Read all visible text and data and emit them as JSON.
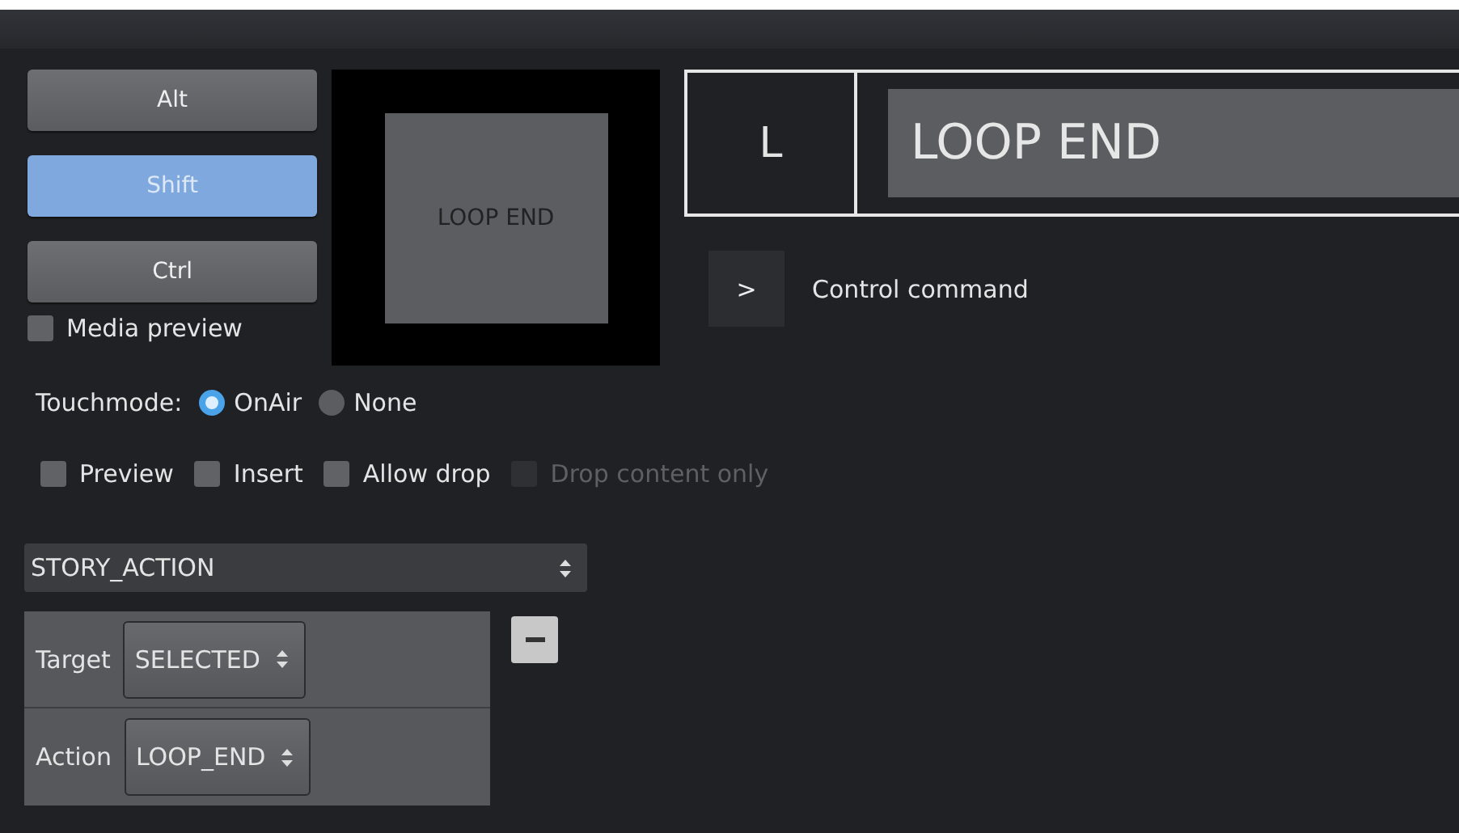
{
  "modifiers": [
    {
      "label": "Alt",
      "selected": false
    },
    {
      "label": "Shift",
      "selected": true
    },
    {
      "label": "Ctrl",
      "selected": false
    }
  ],
  "media_preview": {
    "label": "Media preview",
    "checked": false
  },
  "preview_tile": {
    "label": "LOOP END"
  },
  "shortcut": {
    "key": "L",
    "name": "LOOP END"
  },
  "command": {
    "button": ">",
    "label": "Control command"
  },
  "touchmode": {
    "label": "Touchmode:",
    "options": [
      {
        "label": "OnAir",
        "selected": true
      },
      {
        "label": "None",
        "selected": false
      }
    ]
  },
  "options": [
    {
      "label": "Preview",
      "checked": false,
      "disabled": false
    },
    {
      "label": "Insert",
      "checked": false,
      "disabled": false
    },
    {
      "label": "Allow drop",
      "checked": false,
      "disabled": false
    },
    {
      "label": "Drop content only",
      "checked": false,
      "disabled": true
    }
  ],
  "action_type": {
    "value": "STORY_ACTION"
  },
  "parameters": [
    {
      "label": "Target",
      "value": "SELECTED"
    },
    {
      "label": "Action",
      "value": "LOOP_END"
    }
  ]
}
